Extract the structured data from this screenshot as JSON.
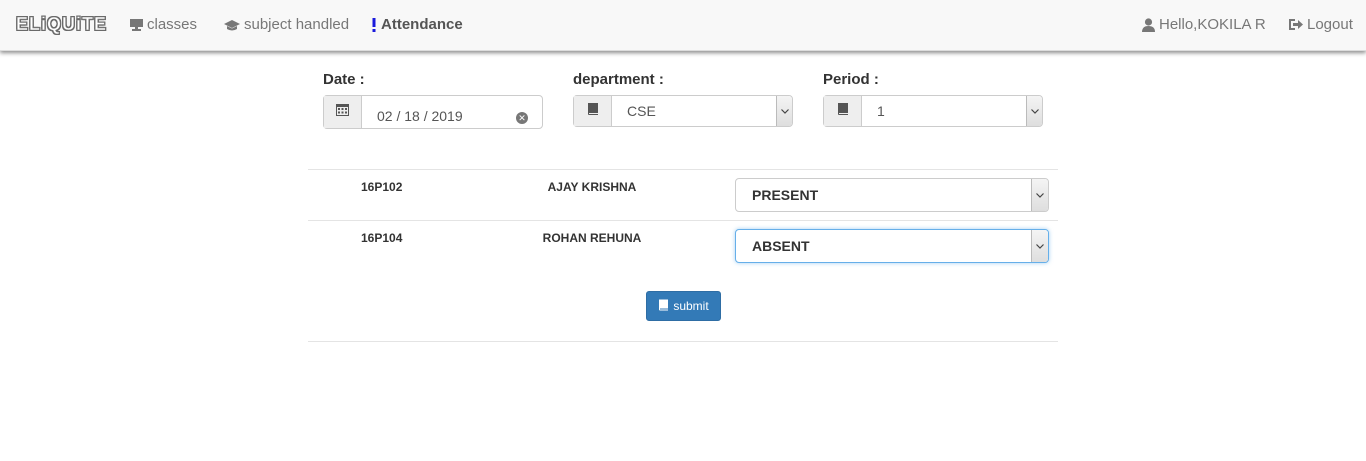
{
  "nav": {
    "brand": "ELiQUiTE",
    "classes": "classes",
    "subject_handled": "subject handled",
    "attendance": "Attendance",
    "user_greeting": "Hello,KOKILA R",
    "logout": "Logout"
  },
  "filters": {
    "date_label": "Date :",
    "date_value": "02 / 18 / 2019",
    "department_label": "department :",
    "department_value": "CSE",
    "period_label": "Period :",
    "period_value": "1"
  },
  "students": [
    {
      "id": "16P102",
      "name": "AJAY KRISHNA",
      "status": "PRESENT"
    },
    {
      "id": "16P104",
      "name": "ROHAN REHUNA",
      "status": "ABSENT"
    }
  ],
  "submit_label": "submit",
  "colors": {
    "primary": "#337ab7",
    "attendance_icon": "#1a1adc"
  },
  "icons": {
    "classes": "monitor-icon",
    "subject": "graduation-cap-icon",
    "attendance": "exclamation-icon",
    "user": "user-icon",
    "logout": "logout-icon",
    "date": "calendar-icon",
    "department": "book-icon",
    "period": "book-icon",
    "submit": "book-icon"
  }
}
